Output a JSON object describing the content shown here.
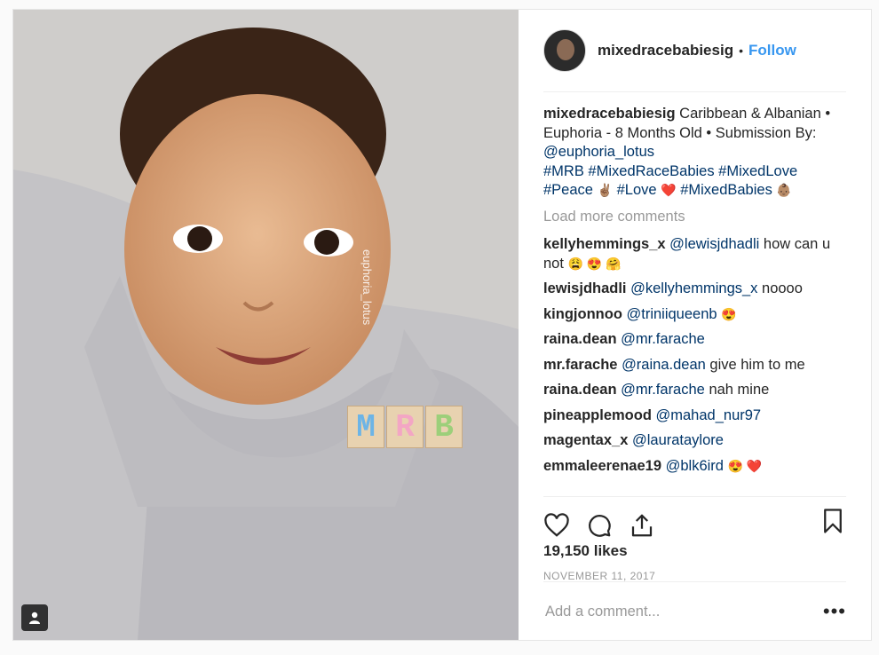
{
  "post": {
    "username": "mixedracebabiesig",
    "follow_label": "Follow",
    "dot": "•",
    "caption": {
      "text": "Caribbean & Albanian • Euphoria - 8 Months Old • Submission By:",
      "mention": "@euphoria_lotus",
      "tags_line1": "#MRB #MixedRaceBabies #MixedLove",
      "tag_peace": "#Peace",
      "emoji_peace": "✌🏽",
      "tag_love": "#Love",
      "emoji_love": "❤️",
      "tag_babies": "#MixedBabies",
      "emoji_babies": "👶🏽"
    },
    "load_more": "Load more comments",
    "comments": [
      {
        "user": "kellyhemmings_x",
        "mention": "@lewisjdhadli",
        "text": "how can u not",
        "emoji": "😩 😍 🤗"
      },
      {
        "user": "lewisjdhadli",
        "mention": "@kellyhemmings_x",
        "text": "noooo",
        "emoji": ""
      },
      {
        "user": "kingjonnoo",
        "mention": "@triniiqueenb",
        "text": "",
        "emoji": "😍"
      },
      {
        "user": "raina.dean",
        "mention": "@mr.farache",
        "text": "",
        "emoji": ""
      },
      {
        "user": "mr.farache",
        "mention": "@raina.dean",
        "text": "give him to me",
        "emoji": ""
      },
      {
        "user": "raina.dean",
        "mention": "@mr.farache",
        "text": "nah mine",
        "emoji": ""
      },
      {
        "user": "pineapplemood",
        "mention": "@mahad_nur97",
        "text": "",
        "emoji": ""
      },
      {
        "user": "magentax_x",
        "mention": "@laurataylore",
        "text": "",
        "emoji": ""
      },
      {
        "user": "emmaleerenae19",
        "mention": "@blk6ird",
        "text": "",
        "emoji": "😍 ❤️"
      }
    ],
    "likes": "19,150 likes",
    "date": "NOVEMBER 11, 2017",
    "add_comment_placeholder": "Add a comment...",
    "more_label": "•••"
  },
  "media": {
    "watermark_text": "euphoria_lotus",
    "logo_letters": [
      "M",
      "R",
      "B"
    ],
    "logo_colors": [
      "#6cb4e6",
      "#f3a6c4",
      "#9ccf7a"
    ]
  },
  "icons": [
    "heart-icon",
    "comment-icon",
    "share-icon",
    "bookmark-icon",
    "user-tag-icon"
  ]
}
